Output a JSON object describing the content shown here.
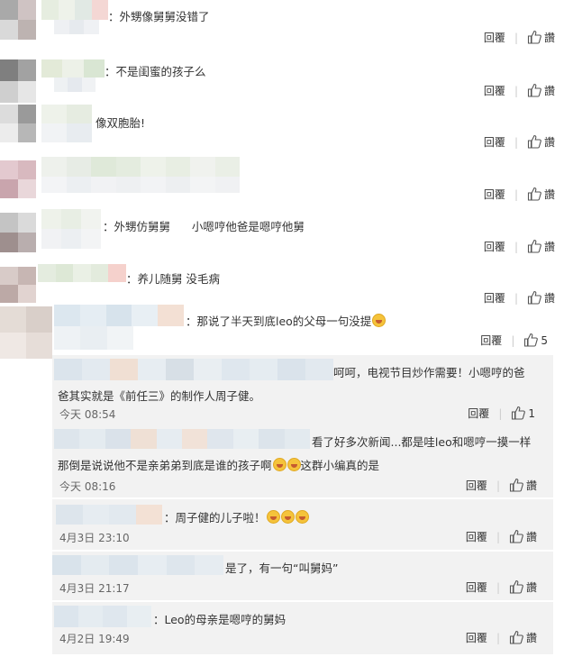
{
  "colors": {
    "reply_bg": "#f2f2f2",
    "text": "#333333",
    "muted": "#666666",
    "mosaic_avatar": [
      "#b8b8b8",
      "#d8c5c5",
      "#a8a8a8",
      "#e3d3d6",
      "#cfcfcf",
      "#bfb1b1"
    ],
    "mosaic_name": [
      "#e8efe3",
      "#dde6ee",
      "#f4e1da",
      "#e4ece0",
      "#d7e2ec"
    ]
  },
  "labels": {
    "reply": "回覆",
    "like": "讚"
  },
  "comments": [
    {
      "text": "：外甥像舅舅没错了"
    },
    {
      "text": "：不是闺蜜的孩子么"
    },
    {
      "text": "像双胞胎!"
    },
    {
      "text": ""
    },
    {
      "text": "：外甥仿舅舅      小嗯哼他爸是嗯哼他舅"
    },
    {
      "text": "：养儿随舅 没毛病"
    },
    {
      "text": "：那说了半天到底leo的父母一句没提",
      "like_count": "5",
      "has_emoji": true
    }
  ],
  "replies": [
    {
      "line1": "呵呵，电视节目炒作需要！小嗯哼的爸",
      "line2": "爸其实就是《前任三》的制作人周子健。",
      "time": "今天 08:54",
      "like": "1"
    },
    {
      "line1": "看了好多次新闻...都是哇leo和嗯哼一摸一样",
      "line2a": "那倒是说说他不是亲弟弟到底是谁的孩子啊",
      "line2b": "这群小编真的是",
      "time": "今天 08:16",
      "like": "讚"
    },
    {
      "line1": "：周子健的儿子啦！",
      "time": "4月3日 23:10",
      "like": "讚"
    },
    {
      "line1": "是了，有一句“叫舅妈”",
      "time": "4月3日 21:17",
      "like": "讚"
    },
    {
      "line1": "：Leo的母亲是嗯哼的舅妈",
      "time": "4月2日 19:49",
      "like": "讚"
    }
  ]
}
